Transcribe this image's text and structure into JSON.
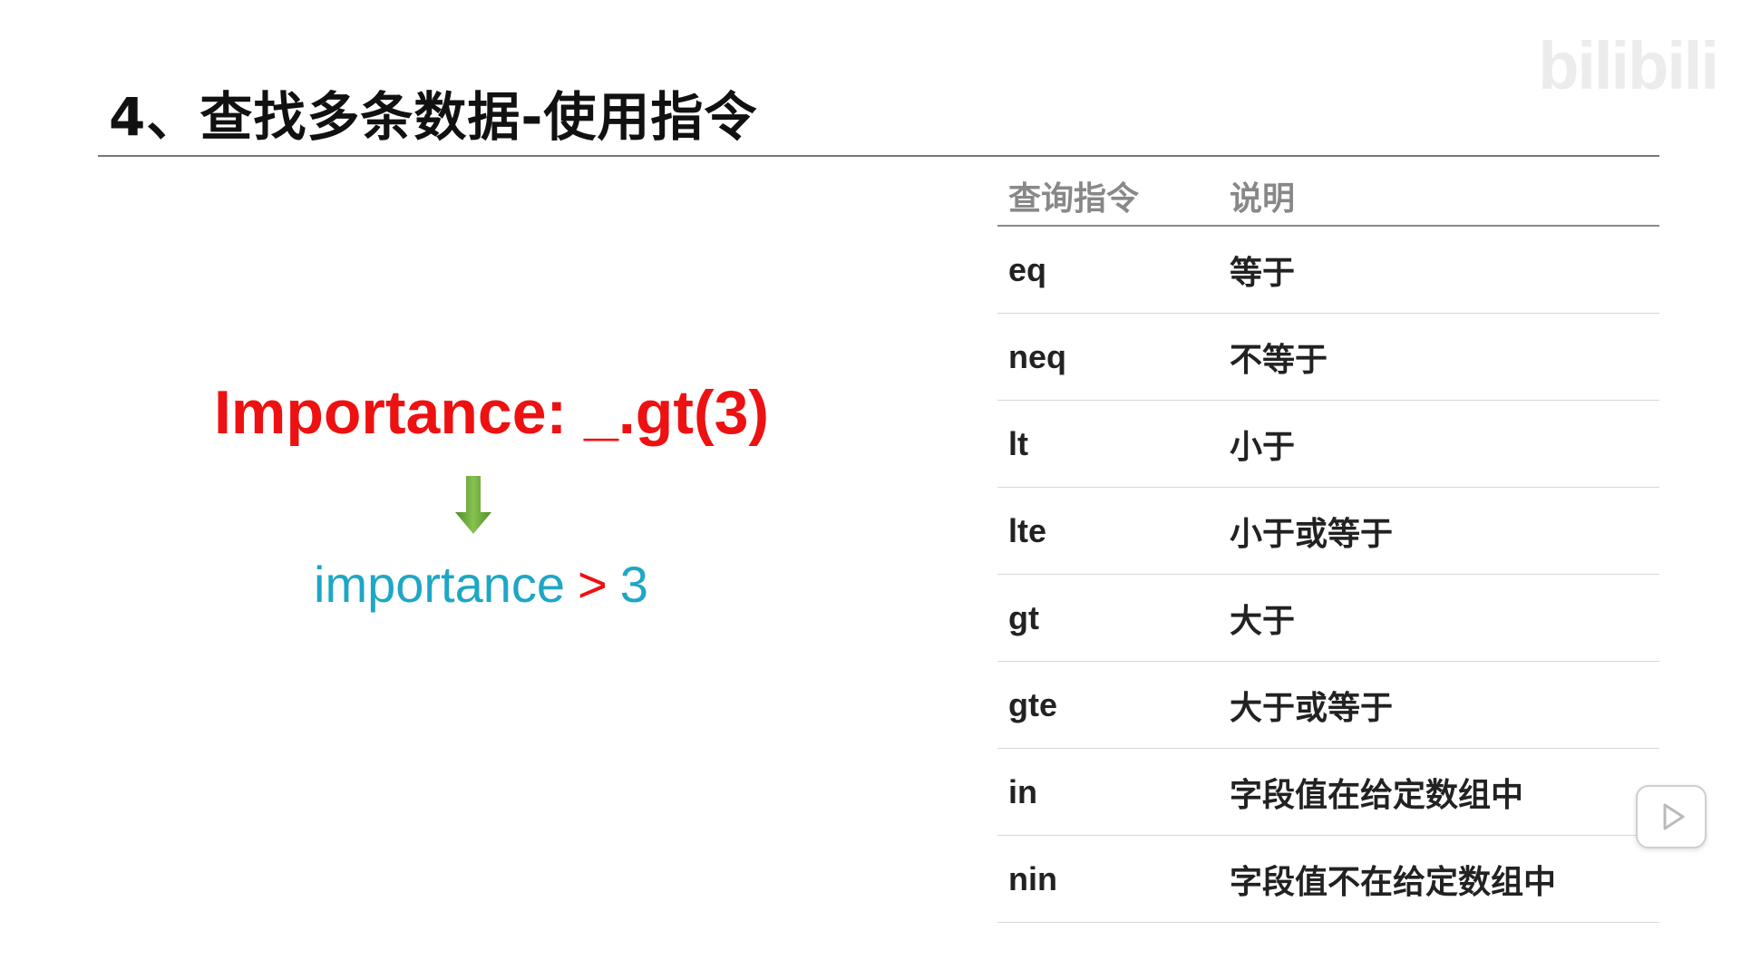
{
  "slide": {
    "title": "4、查找多条数据-使用指令"
  },
  "watermark": {
    "text": "bilibili"
  },
  "example": {
    "expression": "Importance: _.gt(3)",
    "result_field": "importance",
    "result_operator": ">",
    "result_value": "3",
    "arrow_icon": "down-arrow-icon",
    "colors": {
      "expression": "#ee1111",
      "result": "#1ea7c5",
      "arrow": "#6aaa3a"
    }
  },
  "table": {
    "headers": [
      "查询指令",
      "说明"
    ],
    "rows": [
      {
        "cmd": "eq",
        "desc": "等于"
      },
      {
        "cmd": "neq",
        "desc": "不等于"
      },
      {
        "cmd": "lt",
        "desc": "小于"
      },
      {
        "cmd": "lte",
        "desc": "小于或等于"
      },
      {
        "cmd": "gt",
        "desc": "大于"
      },
      {
        "cmd": "gte",
        "desc": "大于或等于"
      },
      {
        "cmd": "in",
        "desc": "字段值在给定数组中"
      },
      {
        "cmd": "nin",
        "desc": "字段值不在给定数组中"
      }
    ]
  },
  "overlay": {
    "play_icon": "play-icon"
  }
}
